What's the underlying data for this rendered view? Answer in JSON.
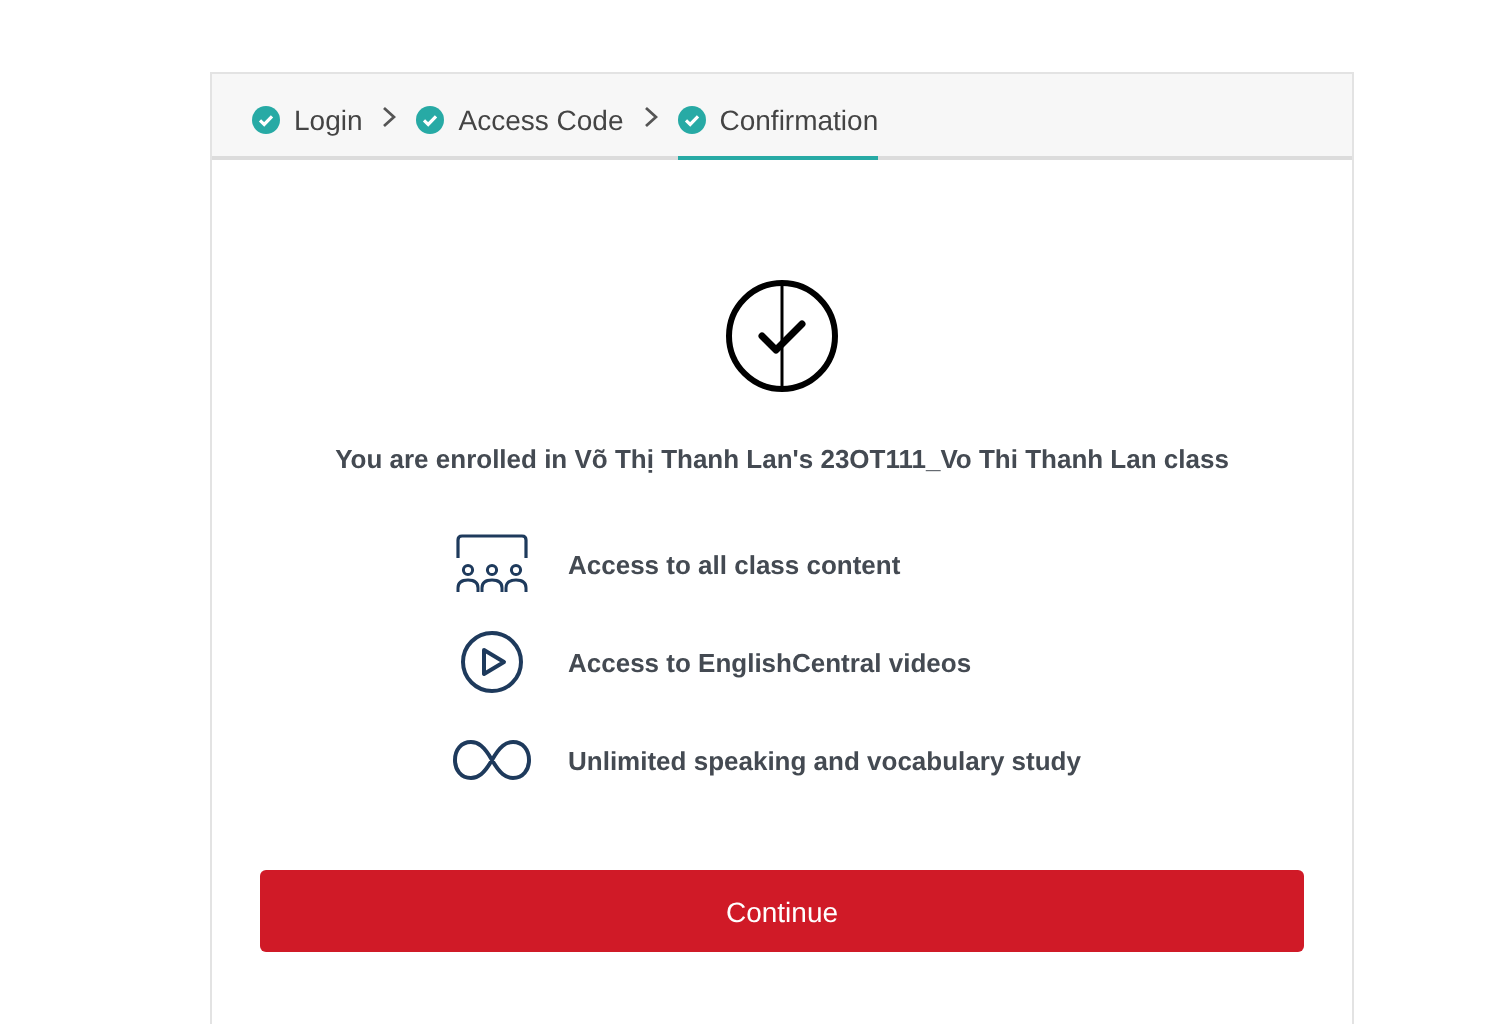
{
  "steps": [
    {
      "label": "Login",
      "done": true,
      "selected": false
    },
    {
      "label": "Access Code",
      "done": true,
      "selected": false
    },
    {
      "label": "Confirmation",
      "done": true,
      "selected": true
    }
  ],
  "message": "You are enrolled in Võ Thị Thanh Lan's 23OT111_Vo Thi Thanh Lan class",
  "features": [
    {
      "kind": "classroom",
      "text": "Access to all class content"
    },
    {
      "kind": "play",
      "text": "Access to EnglishCentral videos"
    },
    {
      "kind": "infinity",
      "text": "Unlimited speaking and vocabulary study"
    }
  ],
  "button": "Continue"
}
